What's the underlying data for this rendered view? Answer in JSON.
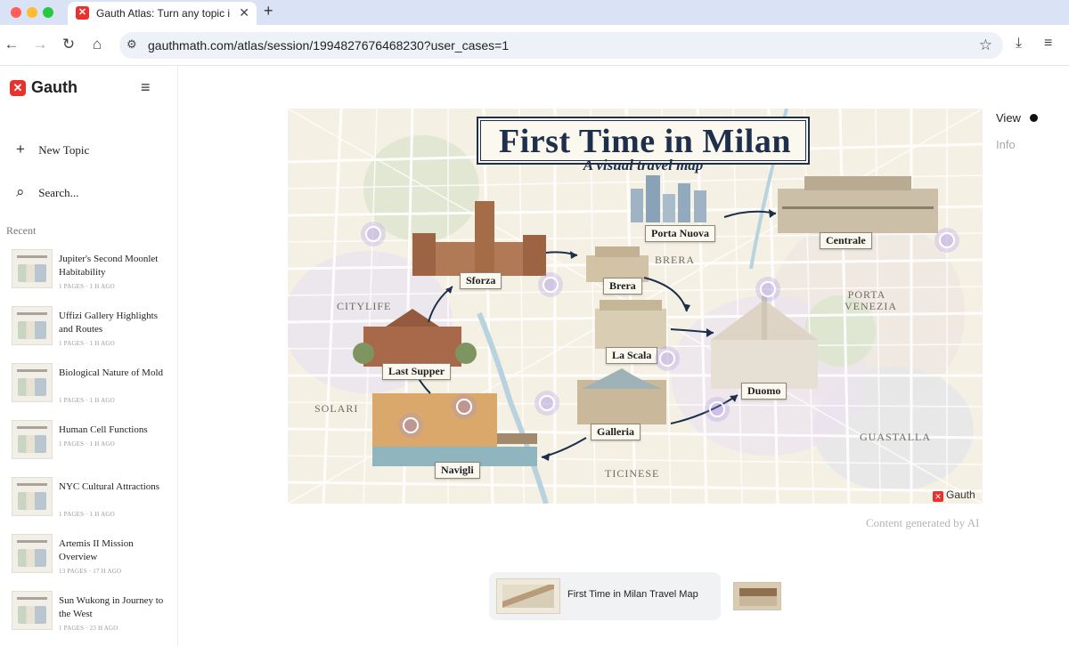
{
  "browser": {
    "tab_title": "Gauth Atlas: Turn any topic in",
    "favicon_glyph": "✕",
    "close_glyph": "✕",
    "new_tab_glyph": "+",
    "url": "gauthmath.com/atlas/session/1994827676468230?user_cases=1",
    "icons": {
      "back": "←",
      "forward": "→",
      "reload": "↻",
      "home": "⌂",
      "site_info": "⚙",
      "star": "☆",
      "download": "⤓",
      "reading_list": "≡"
    }
  },
  "sidebar": {
    "brand": "Gauth",
    "brand_glyph": "✕",
    "menu_glyph": "≡",
    "new_topic": "New Topic",
    "new_topic_glyph": "+",
    "search": "Search...",
    "search_glyph": "⌕",
    "recent_label": "Recent",
    "recent": [
      {
        "title": "Jupiter's Second Moonlet Habitability",
        "meta": "1 PAGES · 1 H AGO"
      },
      {
        "title": "Uffizi Gallery Highlights and Routes",
        "meta": "1 PAGES · 1 H AGO"
      },
      {
        "title": "Biological Nature of Mold",
        "meta": "1 PAGES · 1 H AGO"
      },
      {
        "title": "Human Cell Functions",
        "meta": "1 PAGES · 1 H AGO"
      },
      {
        "title": "NYC Cultural Attractions",
        "meta": "1 PAGES · 1 H AGO"
      },
      {
        "title": "Artemis II Mission Overview",
        "meta": "13 PAGES · 17 H AGO"
      },
      {
        "title": "Sun Wukong in Journey to the West",
        "meta": "1 PAGES · 23 H AGO"
      }
    ]
  },
  "map": {
    "title": "First Time in Milan",
    "subtitle": "A visual travel map",
    "watermark": "Gauth",
    "watermark_glyph": "✕",
    "landmarks": {
      "porta_nuova": "Porta Nuova",
      "centrale": "Centrale",
      "sforza": "Sforza",
      "brera": "Brera",
      "la_scala": "La Scala",
      "last_supper": "Last Supper",
      "duomo": "Duomo",
      "galleria": "Galleria",
      "navigli": "Navigli"
    },
    "districts": {
      "brera": "BRERA",
      "citylife": "CITYLIFE",
      "porta_venezia": "PORTA VENEZIA",
      "solari": "SOLARI",
      "guastalla": "GUASTALLA",
      "ticinese": "TICINESE"
    }
  },
  "panel": {
    "view": "View",
    "info": "Info",
    "ai_note": "Content generated by AI"
  },
  "pages": {
    "current_title": "First Time in Milan Travel Map"
  },
  "colors": {
    "brand_red": "#e8322d",
    "title_navy": "#1d2f4a",
    "map_background": "#f5f0e4"
  }
}
